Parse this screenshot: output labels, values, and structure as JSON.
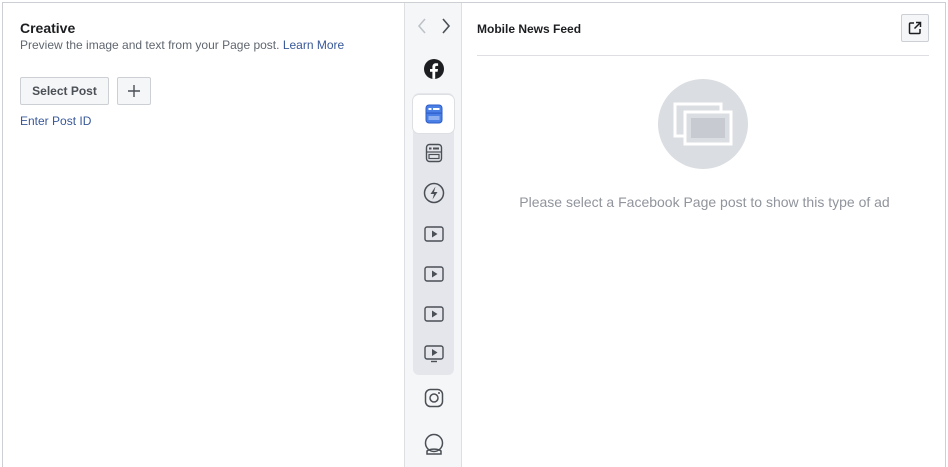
{
  "creative": {
    "title": "Creative",
    "subtitle": "Preview the image and text from your Page post.",
    "learn_more": "Learn More",
    "select_post": "Select Post",
    "enter_post_id": "Enter Post ID"
  },
  "rail": {
    "placements": [
      {
        "icon": "facebook-icon"
      },
      {
        "icon": "mobile-news-feed-icon",
        "selected": true
      },
      {
        "icon": "desktop-news-feed-icon"
      },
      {
        "icon": "instant-articles-icon"
      },
      {
        "icon": "video-icon"
      },
      {
        "icon": "video-icon"
      },
      {
        "icon": "video-icon"
      },
      {
        "icon": "video-icon"
      },
      {
        "icon": "instagram-icon"
      },
      {
        "icon": "messenger-icon"
      }
    ]
  },
  "preview": {
    "title": "Mobile News Feed",
    "empty_message": "Please select a Facebook Page post to show this type of ad"
  },
  "colors": {
    "link": "#385898",
    "selected_icon": "#4a7fe5",
    "icon": "#4b4f56"
  }
}
